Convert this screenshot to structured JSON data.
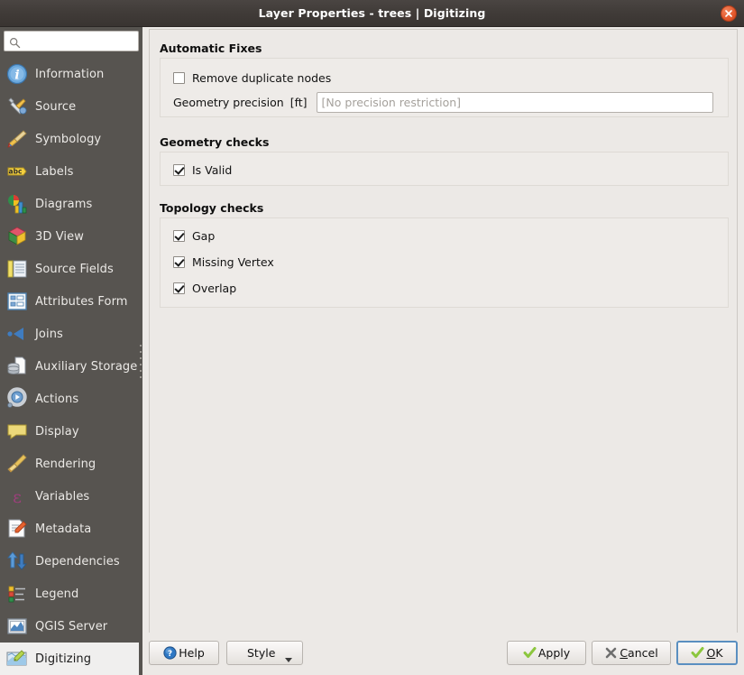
{
  "window": {
    "title": "Layer Properties - trees | Digitizing",
    "close_icon": "close-icon"
  },
  "sidebar": {
    "search": {
      "value": "",
      "placeholder": "",
      "icon": "search-icon"
    },
    "items": [
      {
        "label": "Information",
        "icon": "information-icon",
        "selected": false
      },
      {
        "label": "Source",
        "icon": "source-icon",
        "selected": false
      },
      {
        "label": "Symbology",
        "icon": "symbology-icon",
        "selected": false
      },
      {
        "label": "Labels",
        "icon": "labels-icon",
        "selected": false
      },
      {
        "label": "Diagrams",
        "icon": "diagrams-icon",
        "selected": false
      },
      {
        "label": "3D View",
        "icon": "3d-view-icon",
        "selected": false
      },
      {
        "label": "Source Fields",
        "icon": "source-fields-icon",
        "selected": false
      },
      {
        "label": "Attributes Form",
        "icon": "attributes-form-icon",
        "selected": false
      },
      {
        "label": "Joins",
        "icon": "joins-icon",
        "selected": false
      },
      {
        "label": "Auxiliary Storage",
        "icon": "auxiliary-storage-icon",
        "selected": false
      },
      {
        "label": "Actions",
        "icon": "actions-icon",
        "selected": false
      },
      {
        "label": "Display",
        "icon": "display-icon",
        "selected": false
      },
      {
        "label": "Rendering",
        "icon": "rendering-icon",
        "selected": false
      },
      {
        "label": "Variables",
        "icon": "variables-icon",
        "selected": false
      },
      {
        "label": "Metadata",
        "icon": "metadata-icon",
        "selected": false
      },
      {
        "label": "Dependencies",
        "icon": "dependencies-icon",
        "selected": false
      },
      {
        "label": "Legend",
        "icon": "legend-icon",
        "selected": false
      },
      {
        "label": "QGIS Server",
        "icon": "qgis-server-icon",
        "selected": false
      },
      {
        "label": "Digitizing",
        "icon": "digitizing-icon",
        "selected": true
      }
    ]
  },
  "main": {
    "automatic_fixes": {
      "title": "Automatic Fixes",
      "remove_duplicate_nodes": {
        "label": "Remove duplicate nodes",
        "checked": false
      },
      "geometry_precision": {
        "label": "Geometry precision",
        "unit": "[ft]",
        "value": "",
        "placeholder": "[No precision restriction]"
      }
    },
    "geometry_checks": {
      "title": "Geometry checks",
      "items": [
        {
          "label": "Is Valid",
          "checked": true
        }
      ]
    },
    "topology_checks": {
      "title": "Topology checks",
      "items": [
        {
          "label": "Gap",
          "checked": true
        },
        {
          "label": "Missing Vertex",
          "checked": true
        },
        {
          "label": "Overlap",
          "checked": true
        }
      ]
    }
  },
  "buttonbar": {
    "help": {
      "label": "Help",
      "icon": "help-icon"
    },
    "style": {
      "label": "Style",
      "icon": "chevron-down-icon"
    },
    "apply": {
      "label": "Apply",
      "icon": "check-icon"
    },
    "cancel": {
      "label_pre": "",
      "accel": "C",
      "label_post": "ancel",
      "icon": "cross-icon"
    },
    "ok": {
      "accel": "O",
      "label_post": "K",
      "icon": "check-icon"
    }
  },
  "colors": {
    "titlebar": "#413c39",
    "sidebar": "#575450",
    "panel": "#ece9e6",
    "selected_row": "#f0efee",
    "accent_focus": "#5a8fc0",
    "check_green": "#8cc63e",
    "close_button": "#e2572b"
  }
}
